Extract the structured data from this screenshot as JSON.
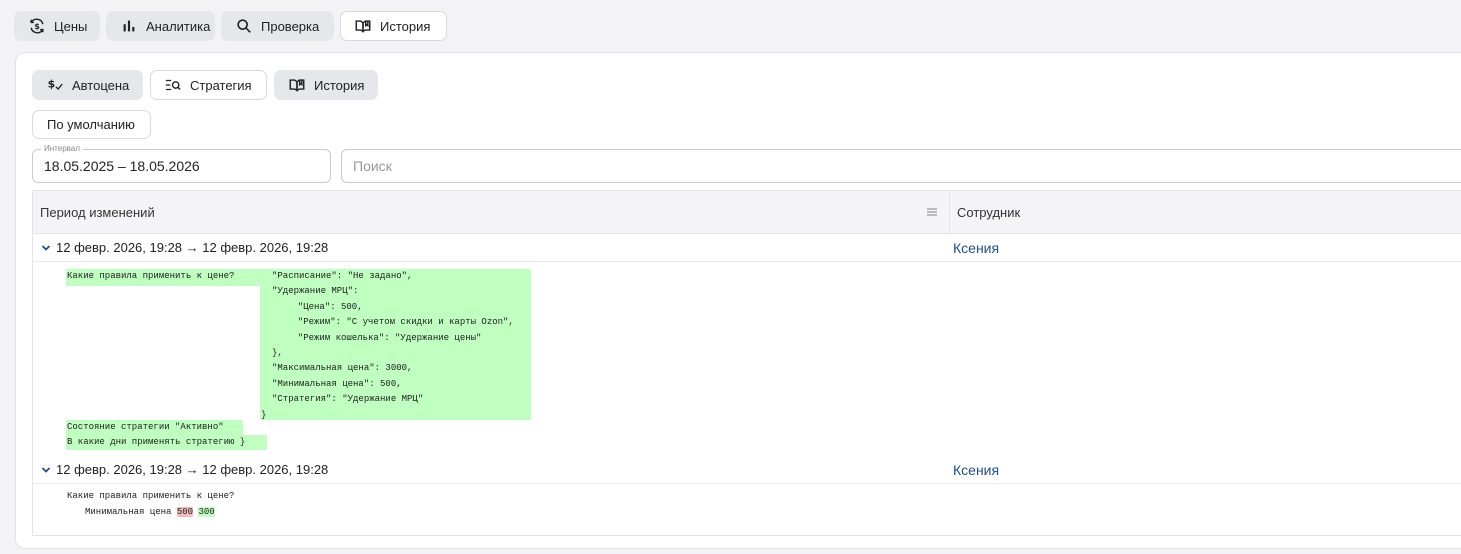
{
  "top_tabs": [
    {
      "label": "Цены",
      "icon": "price-cycle-icon"
    },
    {
      "label": "Аналитика",
      "icon": "bar-chart-icon"
    },
    {
      "label": "Проверка",
      "icon": "search-icon"
    },
    {
      "label": "История",
      "icon": "book-history-icon"
    }
  ],
  "sub_tabs": [
    {
      "label": "Автоцена",
      "icon": "dollar-check-icon"
    },
    {
      "label": "Стратегия",
      "icon": "list-search-icon"
    },
    {
      "label": "История",
      "icon": "book-history-icon"
    }
  ],
  "default_button": "По умолчанию",
  "interval": {
    "label": "Интервал",
    "value": "18.05.2025 – 18.05.2026"
  },
  "search": {
    "placeholder": "Поиск"
  },
  "table": {
    "columns": [
      "Период изменений",
      "Сотрудник"
    ],
    "rows": [
      {
        "period": "12 февр. 2026, 19:28 → 12 февр. 2026, 19:28",
        "employee": "Ксения",
        "question": "Какие правила применить к цене?",
        "json_lines": [
          "\"Расписание\": \"Не задано\",",
          "\"Удержание МРЦ\":",
          "  \"Цена\": 500,",
          "  \"Режим\": \"С учетом скидки и карты Ozon\",",
          "  \"Режим кошелька\": \"Удержание цены\"",
          "},",
          "\"Максимальная цена\": 3000,",
          "\"Минимальная цена\": 500,",
          "\"Стратегия\": \"Удержание МРЦ\"",
          "}"
        ],
        "state_line": "Состояние стратегии \"Активно\"",
        "days_line": "В какие дни применять стратегию }"
      },
      {
        "period": "12 февр. 2026, 19:28 → 12 февр. 2026, 19:28",
        "employee": "Ксения",
        "question": "Какие правила применить к цене?",
        "change_label": "Минимальная цена",
        "old_value": "500",
        "new_value": "300"
      }
    ]
  }
}
